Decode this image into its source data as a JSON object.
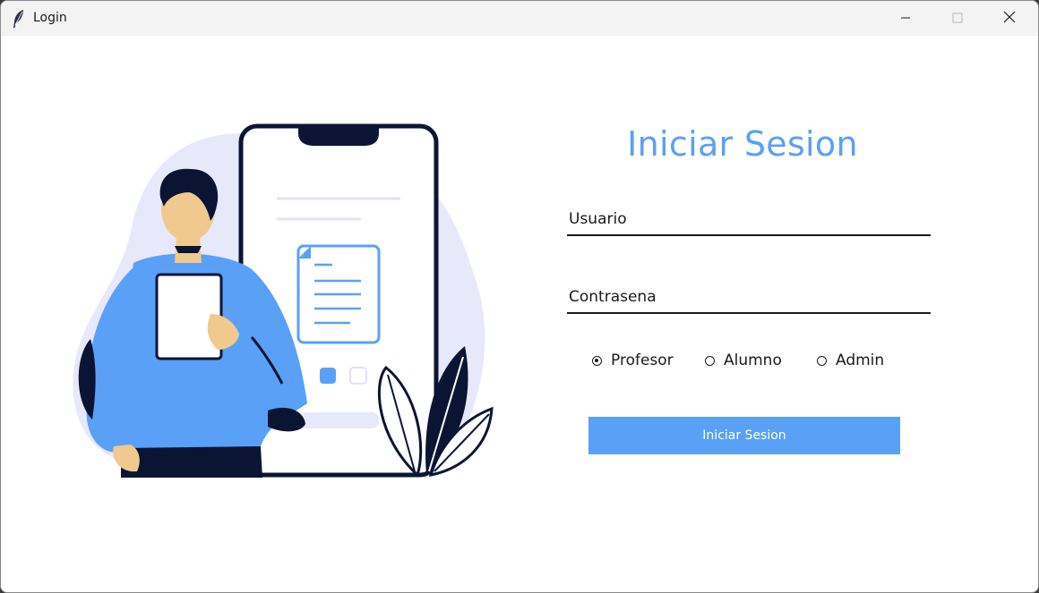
{
  "window": {
    "title": "Login",
    "icon": "feather-icon",
    "controls": [
      "minimize-icon",
      "maximize-icon",
      "close-icon"
    ]
  },
  "form": {
    "heading": "Iniciar Sesion",
    "username_placeholder": "Usuario",
    "password_placeholder": "Contrasena",
    "roles": [
      {
        "label": "Profesor",
        "checked": true
      },
      {
        "label": "Alumno",
        "checked": false
      },
      {
        "label": "Admin",
        "checked": false
      }
    ],
    "submit_label": "Iniciar Sesion"
  },
  "colors": {
    "accent": "#5aa0f7",
    "navy": "#0b1533",
    "blob": "#e8e8fb",
    "skin": "#f0c98f"
  }
}
